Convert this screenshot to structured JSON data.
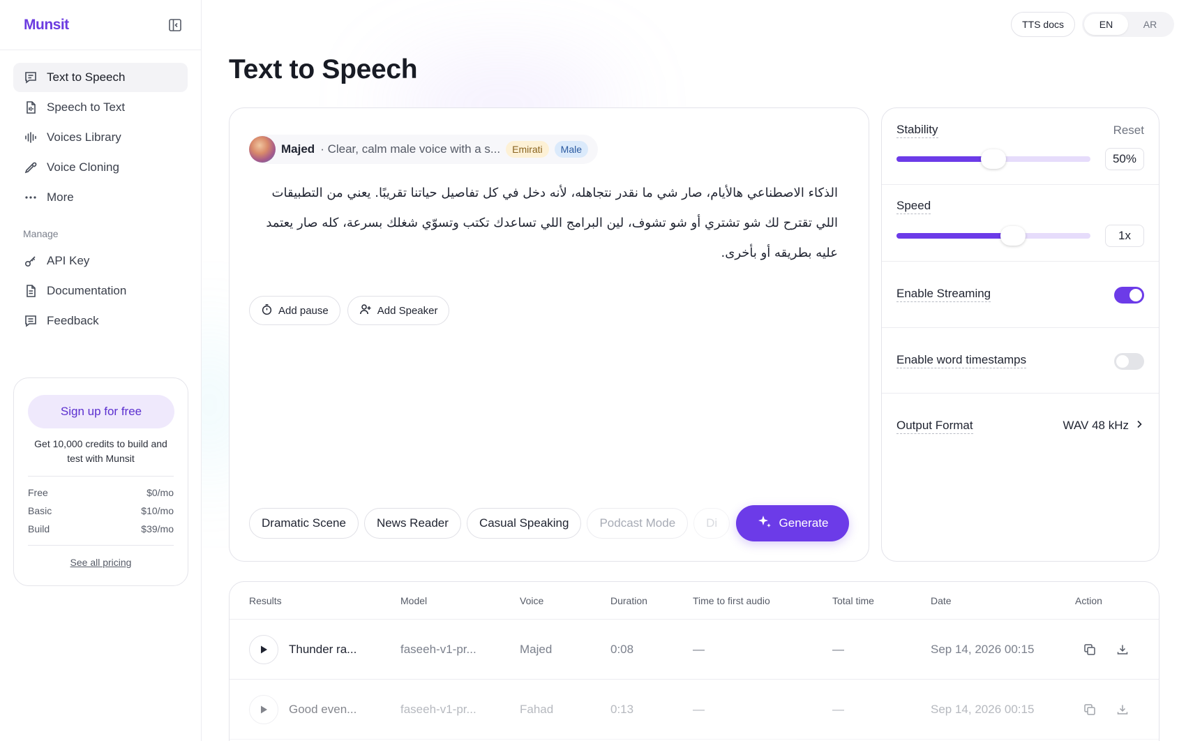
{
  "app": {
    "logo": "Munsit"
  },
  "sidebar": {
    "items": [
      {
        "label": "Text to Speech",
        "icon": "message-square-text-icon",
        "active": true
      },
      {
        "label": "Speech to Text",
        "icon": "file-audio-icon"
      },
      {
        "label": "Voices Library",
        "icon": "audio-lines-icon"
      },
      {
        "label": "Voice Cloning",
        "icon": "pipette-icon"
      },
      {
        "label": "More",
        "icon": "more-horizontal-icon"
      }
    ],
    "manage_label": "Manage",
    "manage_items": [
      {
        "label": "API Key",
        "icon": "key-icon"
      },
      {
        "label": "Documentation",
        "icon": "file-text-icon"
      },
      {
        "label": "Feedback",
        "icon": "message-square-icon"
      }
    ],
    "promo": {
      "button": "Sign up for free",
      "text": "Get 10,000 credits to build and test with Munsit",
      "plans": [
        {
          "name": "Free",
          "price": "$0/mo"
        },
        {
          "name": "Basic",
          "price": "$10/mo"
        },
        {
          "name": "Build",
          "price": "$39/mo"
        }
      ],
      "see_all": "See all pricing"
    }
  },
  "topbar": {
    "docs": "TTS docs",
    "lang_en": "EN",
    "lang_ar": "AR",
    "active_lang": "EN"
  },
  "page": {
    "title": "Text to Speech"
  },
  "editor": {
    "voice": {
      "name": "Majed",
      "description": "· Clear, calm male voice with a s...",
      "tags": [
        "Emirati",
        "Male"
      ]
    },
    "text": "الذكاء الاصطناعي هالأيام، صار شي ما نقدر نتجاهله، لأنه دخل في كل تفاصيل حياتنا تقريبًا. يعني من التطبيقات اللي تقترح لك شو تشتري أو شو تشوف، لين البرامج اللي تساعدك تكتب وتسوّي شغلك بسرعة، كله صار يعتمد عليه بطريقه أو بأخرى.",
    "add_pause": "Add pause",
    "add_speaker": "Add Speaker",
    "presets": [
      "Dramatic Scene",
      "News Reader",
      "Casual Speaking",
      "Podcast Mode",
      "Di"
    ],
    "generate": "Generate"
  },
  "settings": {
    "stability": {
      "label": "Stability",
      "reset": "Reset",
      "value": "50%",
      "fraction": 0.5
    },
    "speed": {
      "label": "Speed",
      "value": "1x",
      "fraction": 0.6
    },
    "streaming": {
      "label": "Enable Streaming",
      "enabled": true
    },
    "timestamps": {
      "label": "Enable word timestamps",
      "enabled": false
    },
    "output": {
      "label": "Output Format",
      "value": "WAV 48 kHz"
    }
  },
  "results": {
    "headers": [
      "Results",
      "Model",
      "Voice",
      "Duration",
      "Time to first audio",
      "Total time",
      "Date",
      "Action"
    ],
    "rows": [
      {
        "title": "Thunder ra...",
        "model": "faseeh-v1-pr...",
        "voice": "Majed",
        "duration": "0:08",
        "ttfa": "—",
        "total": "—",
        "date": "Sep 14, 2026 00:15"
      },
      {
        "title": "Good even...",
        "model": "faseeh-v1-pr...",
        "voice": "Fahad",
        "duration": "0:13",
        "ttfa": "—",
        "total": "—",
        "date": "Sep 14, 2026 00:15"
      }
    ]
  },
  "colors": {
    "accent": "#6c3be8",
    "accent_light": "#efe9fc"
  }
}
